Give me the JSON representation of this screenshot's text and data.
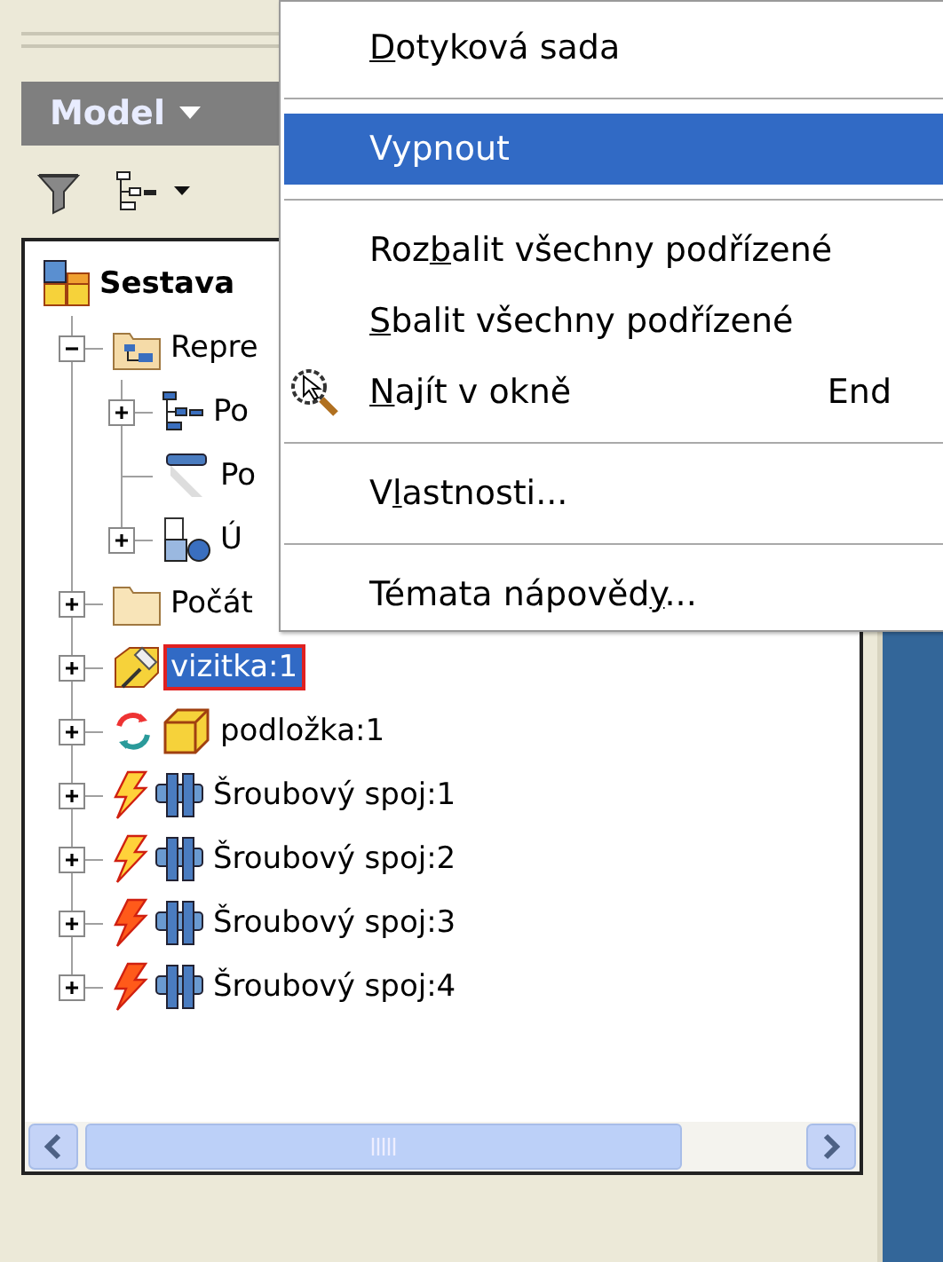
{
  "panel": {
    "title": "Model"
  },
  "tree": [
    {
      "label": "Sestava",
      "kind": "assembly",
      "selected": false,
      "children": [
        {
          "label": "Repre",
          "kind": "representations",
          "expanded": true,
          "selected": false,
          "children": [
            {
              "label": "Po",
              "kind": "view",
              "expanded": false,
              "selected": false
            },
            {
              "label": "Po",
              "kind": "position",
              "selected": false
            },
            {
              "label": "Ú",
              "kind": "detail",
              "expanded": false,
              "selected": false
            }
          ]
        },
        {
          "label": "Počát",
          "kind": "folder",
          "expanded": false,
          "selected": false
        },
        {
          "label": "vizitka:1",
          "kind": "part-pinned",
          "expanded": false,
          "selected": true
        },
        {
          "label": "podložka:1",
          "kind": "part-adaptive",
          "expanded": false,
          "selected": false
        },
        {
          "label": "Šroubový spoj:1",
          "kind": "joint-warning",
          "expanded": false,
          "selected": false
        },
        {
          "label": "Šroubový spoj:2",
          "kind": "joint-warning",
          "expanded": false,
          "selected": false
        },
        {
          "label": "Šroubový spoj:3",
          "kind": "joint-error",
          "expanded": false,
          "selected": false
        },
        {
          "label": "Šroubový spoj:4",
          "kind": "joint-error",
          "expanded": false,
          "selected": false
        }
      ]
    }
  ],
  "context_menu": [
    {
      "kind": "item",
      "parts": [
        {
          "text": "D",
          "mnemonic": true
        },
        {
          "text": "otyková sada",
          "mnemonic": false
        }
      ],
      "selected": false
    },
    {
      "kind": "separator"
    },
    {
      "kind": "item",
      "parts": [
        {
          "text": "Vypnout",
          "mnemonic": false
        }
      ],
      "selected": true
    },
    {
      "kind": "separator"
    },
    {
      "kind": "item",
      "parts": [
        {
          "text": "Roz",
          "mnemonic": false
        },
        {
          "text": "b",
          "mnemonic": true
        },
        {
          "text": "alit všechny podřízené",
          "mnemonic": false
        }
      ],
      "selected": false
    },
    {
      "kind": "item",
      "parts": [
        {
          "text": "S",
          "mnemonic": true
        },
        {
          "text": "balit všechny podřízené",
          "mnemonic": false
        }
      ],
      "selected": false
    },
    {
      "kind": "find-item",
      "parts": [
        {
          "text": "N",
          "mnemonic": true
        },
        {
          "text": "ajít v okně",
          "mnemonic": false
        }
      ],
      "shortcut": "End",
      "selected": false
    },
    {
      "kind": "separator"
    },
    {
      "kind": "item",
      "parts": [
        {
          "text": "V",
          "mnemonic": false
        },
        {
          "text": "l",
          "mnemonic": true
        },
        {
          "text": "astnosti...",
          "mnemonic": false
        }
      ],
      "selected": false
    },
    {
      "kind": "separator"
    },
    {
      "kind": "item",
      "parts": [
        {
          "text": "Témata nápověd",
          "mnemonic": false
        },
        {
          "text": "y",
          "mnemonic": true
        },
        {
          "text": "...",
          "mnemonic": false
        }
      ],
      "selected": false
    }
  ]
}
